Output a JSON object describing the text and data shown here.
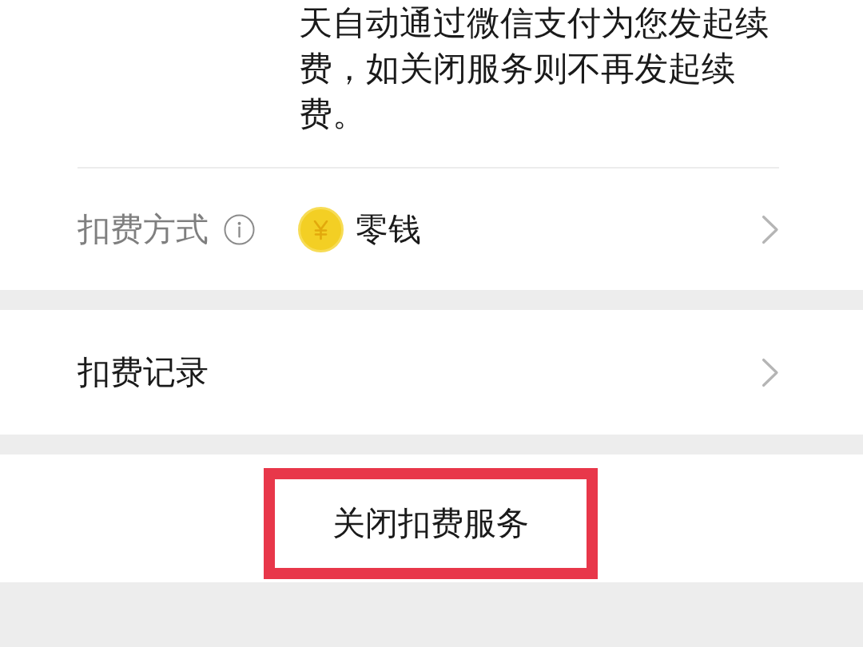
{
  "description": "天自动通过微信支付为您发起续费，如关闭服务则不再发起续费。",
  "payment_method": {
    "label": "扣费方式",
    "value": "零钱"
  },
  "records": {
    "label": "扣费记录"
  },
  "close_button": {
    "label": "关闭扣费服务",
    "highlighted": true
  }
}
